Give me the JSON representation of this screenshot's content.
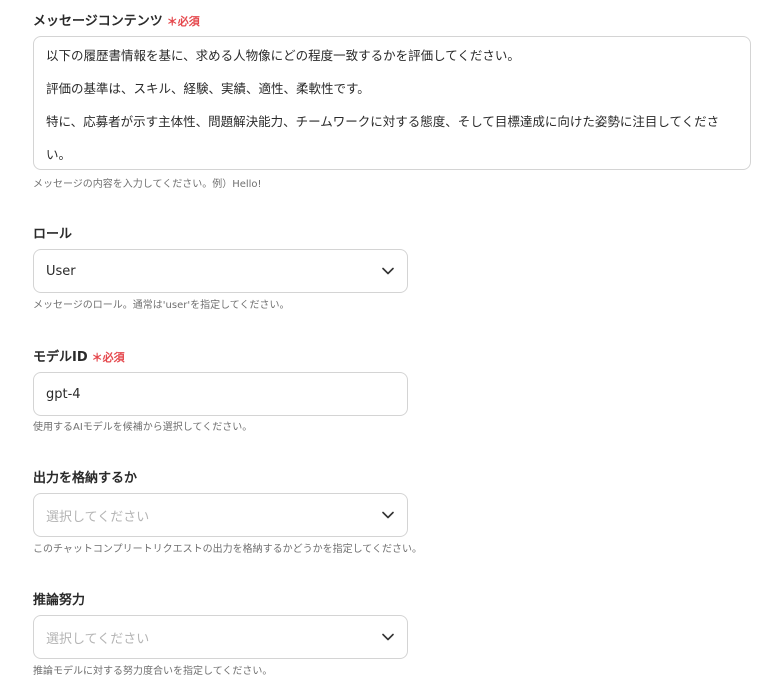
{
  "message_content": {
    "label": "メッセージコンテンツ",
    "required": "＊必須",
    "lines": [
      "以下の履歴書情報を基に、求める人物像にどの程度一致するかを評価してください。",
      "評価の基準は、スキル、経験、実績、適性、柔軟性です。",
      "特に、応募者が示す主体性、問題解決能力、チームワークに対する態度、そして目標達成に向けた姿勢に注目してくださ",
      "い。"
    ],
    "help": "メッセージの内容を入力してください。例）Hello!"
  },
  "role": {
    "label": "ロール",
    "value": "User",
    "help": "メッセージのロール。通常は'user'を指定してください。",
    "icon": "chevron-down-icon"
  },
  "model_id": {
    "label": "モデルID",
    "required": "＊必須",
    "value": "gpt-4",
    "help": "使用するAIモデルを候補から選択してください。"
  },
  "output_store": {
    "label": "出力を格納するか",
    "placeholder": "選択してください",
    "help": "このチャットコンプリートリクエストの出力を格納するかどうかを指定してください。",
    "icon": "chevron-down-icon"
  },
  "reasoning_effort": {
    "label": "推論努力",
    "placeholder": "選択してください",
    "help": "推論モデルに対する努力度合いを指定してください。",
    "icon": "chevron-down-icon"
  },
  "colors": {
    "required": "#e5484d",
    "border": "#d4d4d4",
    "placeholder": "#b5b5b5"
  }
}
